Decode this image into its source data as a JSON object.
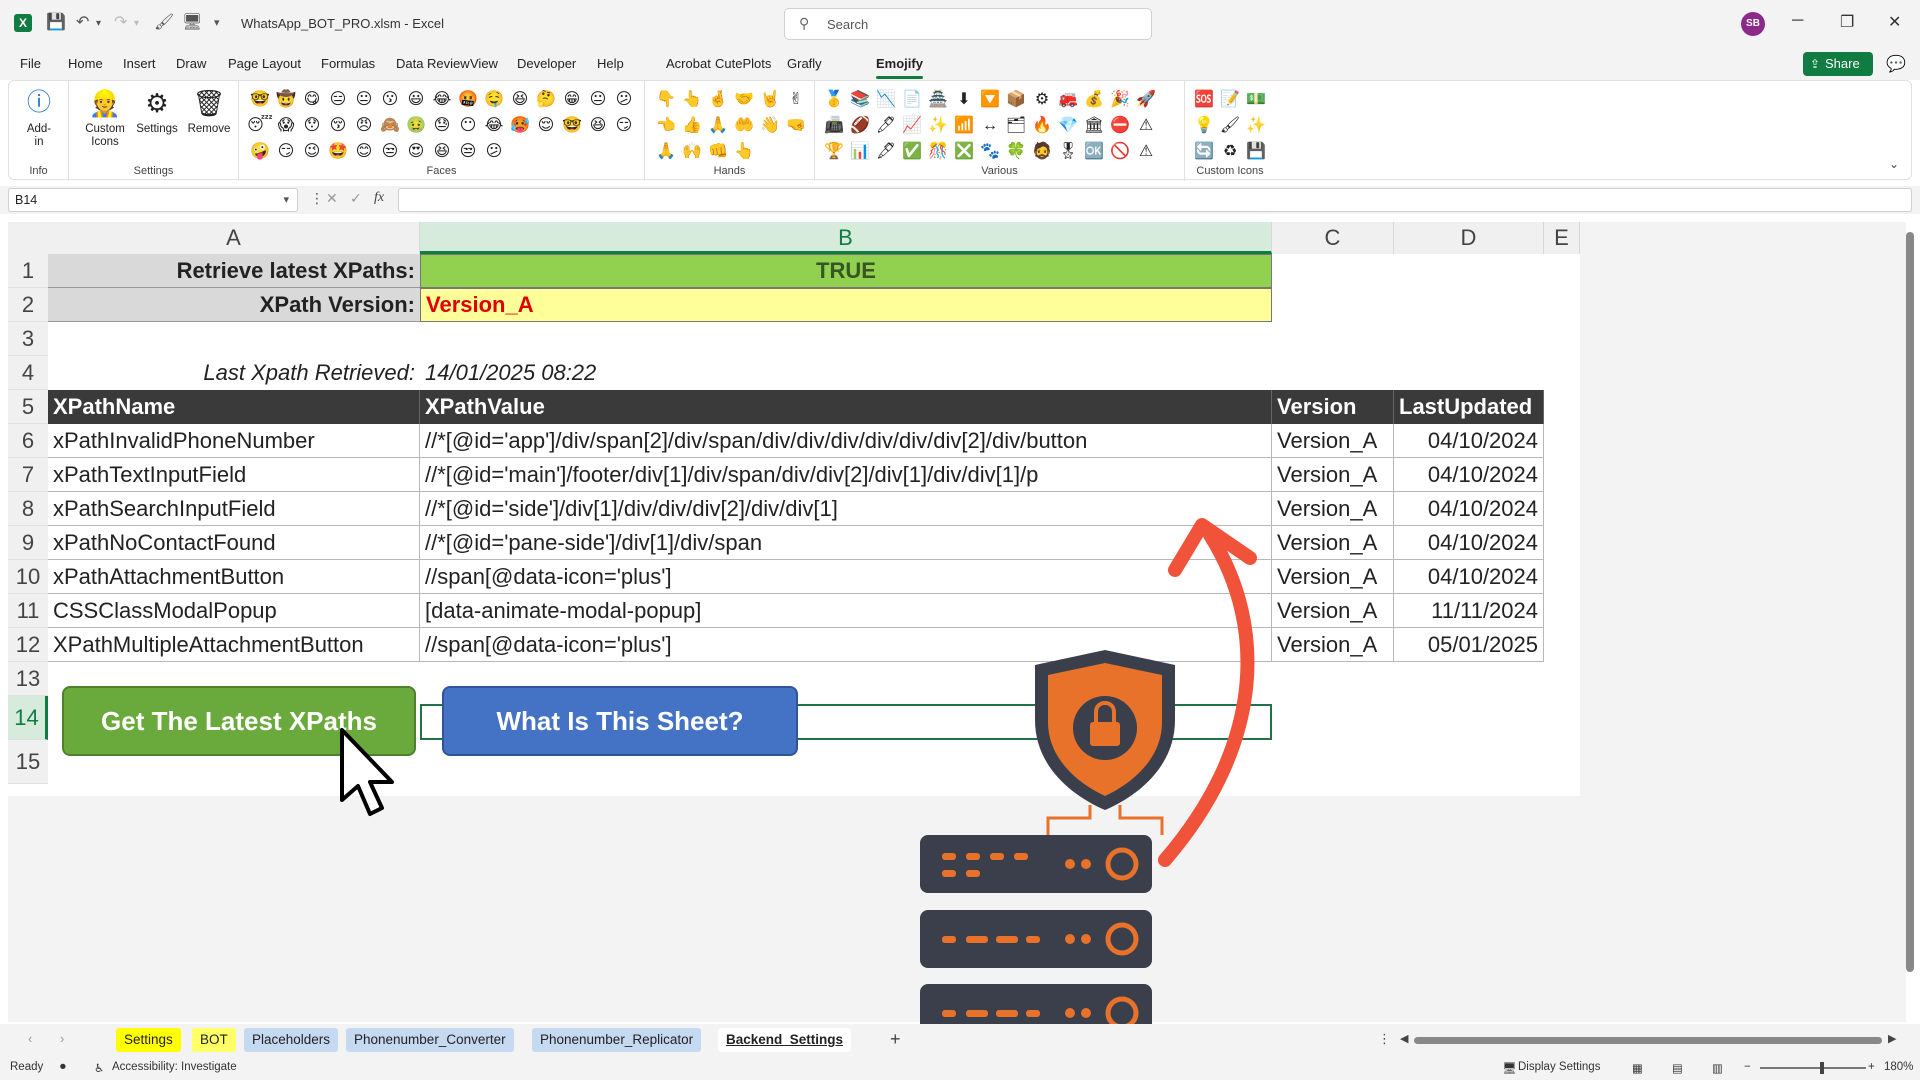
{
  "titlebar": {
    "filename": "WhatsApp_BOT_PRO.xlsm  -  Excel",
    "search_placeholder": "Search",
    "avatar_initials": "SB"
  },
  "ribbon_tabs": [
    "File",
    "Home",
    "Insert",
    "Draw",
    "Page Layout",
    "Formulas",
    "Data",
    "Review",
    "View",
    "Developer",
    "Help",
    "Acrobat",
    "CutePlots",
    "Grafly",
    "Emojify"
  ],
  "active_tab": "Emojify",
  "share_label": "Share",
  "ribbon": {
    "addin_label": "Add-\nin",
    "info_group": "Info",
    "custom_icons_label": "Custom\nIcons",
    "settings_label": "Settings",
    "remove_label": "Remove",
    "settings_group": "Settings",
    "faces_group": "Faces",
    "hands_group": "Hands",
    "various_group": "Various",
    "custom_icons_group": "Custom Icons",
    "faces": [
      "🤓",
      "🤠",
      "😋",
      "😑",
      "😐",
      "😗",
      "😃",
      "😂",
      "🤬",
      "🤤",
      "😆",
      "🤔",
      "😁",
      "😐",
      "😕",
      "😴",
      "😱",
      "😯",
      "😚",
      "😠",
      "🙈",
      "🤢",
      "😓",
      "😶",
      "😂",
      "🥵",
      "😌",
      "🤓",
      "😆",
      "😏",
      "🤪",
      "😏",
      "😉",
      "🤩",
      "😊",
      "😒",
      "😍",
      "😆",
      "😒",
      "😕"
    ],
    "hands": [
      "👇",
      "👆",
      "🤞",
      "🤝",
      "🤘",
      "✌",
      "👈",
      "👍",
      "🙏",
      "🤲",
      "👋",
      "🤜",
      "🙏",
      "🙌",
      "👊",
      "👆"
    ],
    "various": [
      "🥇",
      "📚",
      "📉",
      "📄",
      "🏯",
      "⬇",
      "🔽",
      "📦",
      "⚙",
      "🚒",
      "💰",
      "🎉",
      "🚀",
      "📠",
      "🏈",
      "🖊",
      "📈",
      "✨",
      "📶",
      "↔",
      "🗂",
      "🔥",
      "💎",
      "🏛",
      "⛔",
      "⚠",
      "🏆",
      "📊",
      "🖋",
      "✅",
      "🎊",
      "❎",
      "🐾",
      "🍀",
      "🧔",
      "🎖",
      "🆗",
      "🚫",
      "⚠"
    ],
    "custom_icons": [
      "🆘",
      "📝",
      "💵",
      "💡",
      "🖌",
      "✨",
      "🔄",
      "♻",
      "💾"
    ]
  },
  "formula_bar": {
    "name_box": "B14",
    "fx": "fx",
    "formula": ""
  },
  "columns": [
    {
      "label": "A",
      "selected": false
    },
    {
      "label": "B",
      "selected": true
    },
    {
      "label": "C",
      "selected": false
    },
    {
      "label": "D",
      "selected": false
    },
    {
      "label": "E",
      "selected": false
    }
  ],
  "rows": [
    "1",
    "2",
    "3",
    "4",
    "5",
    "6",
    "7",
    "8",
    "9",
    "10",
    "11",
    "12",
    "13",
    "14",
    "15"
  ],
  "selected_row": "14",
  "sheet": {
    "retrieve_label": "Retrieve latest XPaths:",
    "retrieve_value": "TRUE",
    "version_label": "XPath Version:",
    "version_value": "Version_A",
    "last_label": "Last Xpath Retrieved:",
    "last_value": "14/01/2025 08:22",
    "headers": [
      "XPathName",
      "XPathValue",
      "Version",
      "LastUpdated"
    ],
    "table": [
      [
        "xPathInvalidPhoneNumber",
        "//*[@id='app']/div/span[2]/div/span/div/div/div/div/div/div[2]/div/button",
        "Version_A",
        "04/10/2024"
      ],
      [
        "xPathTextInputField",
        "//*[@id='main']/footer/div[1]/div/span/div/div[2]/div[1]/div/div[1]/p",
        "Version_A",
        "04/10/2024"
      ],
      [
        "xPathSearchInputField",
        "//*[@id='side']/div[1]/div/div/div[2]/div/div[1]",
        "Version_A",
        "04/10/2024"
      ],
      [
        "xPathNoContactFound",
        "//*[@id='pane-side']/div[1]/div/span",
        "Version_A",
        "04/10/2024"
      ],
      [
        "xPathAttachmentButton",
        "//span[@data-icon='plus']",
        "Version_A",
        "04/10/2024"
      ],
      [
        "CSSClassModalPopup",
        "[data-animate-modal-popup]",
        "Version_A",
        "11/11/2024"
      ],
      [
        "XPathMultipleAttachmentButton",
        "//span[@data-icon='plus']",
        "Version_A",
        "05/01/2025"
      ]
    ],
    "btn_latest": "Get The Latest XPaths",
    "btn_what": "What Is This Sheet?"
  },
  "sheet_tabs": [
    {
      "label": "Settings",
      "color": "#ffff00"
    },
    {
      "label": "BOT",
      "color": "#ffff66"
    },
    {
      "label": "Placeholders",
      "color": "#c5d9f1"
    },
    {
      "label": "Phonenumber_Converter",
      "color": "#c5d9f1"
    },
    {
      "label": "Phonenumber_Replicator",
      "color": "#c5d9f1"
    },
    {
      "label": "Backend_Settings",
      "color": "#ffffff"
    }
  ],
  "active_sheet": "Backend_Settings",
  "statusbar": {
    "ready": "Ready",
    "accessibility": "Accessibility: Investigate",
    "display_settings": "Display Settings",
    "zoom": "180%"
  },
  "colors": {
    "true_bg": "#92d050",
    "version_bg": "#ffff99",
    "version_text": "#e00000",
    "header_bg": "#3a3a3a",
    "btn_green": "#6aaa3c",
    "btn_blue": "#4472c4",
    "arrow": "#f0533a",
    "shield": "#e8722a",
    "server": "#3a3f4b"
  }
}
